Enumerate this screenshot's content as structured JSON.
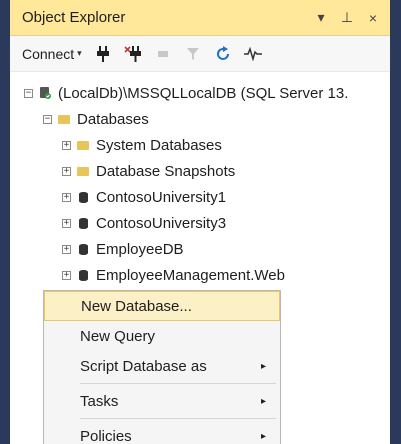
{
  "panel": {
    "title": "Object Explorer",
    "buttons": {
      "dropdown": "▾",
      "pin": "⊥",
      "close": "×"
    }
  },
  "toolbar": {
    "connect_label": "Connect",
    "connect_caret": "▾"
  },
  "tree": {
    "server": "(LocalDb)\\MSSQLLocalDB (SQL Server 13.",
    "databases_label": "Databases",
    "items": [
      {
        "label": "System Databases",
        "icon": "folder-icon"
      },
      {
        "label": "Database Snapshots",
        "icon": "folder-icon"
      },
      {
        "label": "ContosoUniversity1",
        "icon": "database-icon"
      },
      {
        "label": "ContosoUniversity3",
        "icon": "database-icon"
      },
      {
        "label": "EmployeeDB",
        "icon": "database-icon"
      },
      {
        "label": "EmployeeManagement.Web",
        "icon": "database-icon"
      }
    ],
    "expand_plus": "+",
    "expand_minus": "−"
  },
  "context_menu": {
    "items": [
      {
        "label": "New Database...",
        "highlighted": true
      },
      {
        "label": "New Query"
      },
      {
        "label": "Script Database as",
        "submenu": "▸"
      },
      {
        "label": "Tasks",
        "submenu": "▸"
      },
      {
        "label": "Policies",
        "submenu": "▸"
      }
    ]
  },
  "colors": {
    "title_bar": "#ffe89a",
    "highlight": "#fbf0c6",
    "folder": "#e8c55a",
    "background": "#2b3a5a"
  }
}
